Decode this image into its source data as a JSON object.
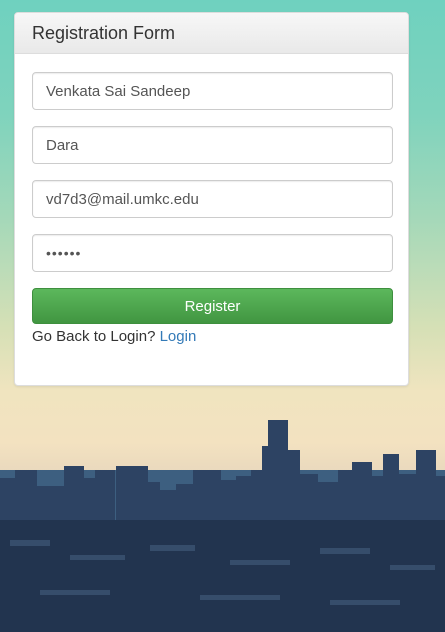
{
  "form": {
    "title": "Registration Form",
    "first_name": "Venkata Sai Sandeep",
    "last_name": "Dara",
    "email": "vd7d3@mail.umkc.edu",
    "password": "••••••",
    "register_label": "Register",
    "back_text": "Go Back to Login?",
    "login_link": "Login"
  },
  "colors": {
    "primary_button": "#5cb85c",
    "link": "#337ab7"
  }
}
